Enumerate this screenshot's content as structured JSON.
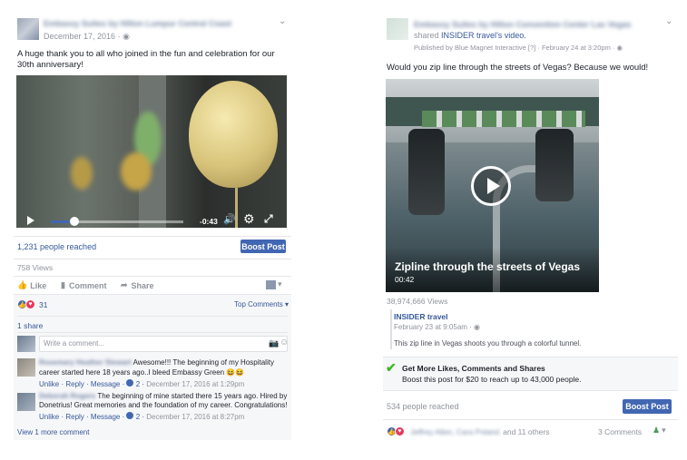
{
  "left_post": {
    "page_name": "Embassy Suites by Hilton Lumpur Central Coast",
    "date": "December 17, 2016",
    "text": "A huge thank you to all who joined in the fun and celebration for our 30th anniversary!",
    "video": {
      "time_remaining": "-0:43",
      "progress": 0.18
    },
    "people_reached": "1,231 people reached",
    "boost_label": "Boost Post",
    "views": "758 Views",
    "actions": {
      "like": "Like",
      "comment": "Comment",
      "share": "Share"
    },
    "reaction_count": "31",
    "top_comments": "Top Comments",
    "shares": "1 share",
    "comment_placeholder": "Write a comment...",
    "comments": [
      {
        "name": "Rosemary Heather Stewart",
        "text": "Awesome!!! The beginning of my Hospitality career started here 18 years ago..I bleed Embassy Green",
        "unlike": "Unlike",
        "reply": "Reply",
        "message": "Message",
        "likes": "2",
        "date": "December 17, 2016 at 1:29pm"
      },
      {
        "name": "Deborah Rogers",
        "text": "The beginning of mine started there 15 years ago. Hired by Donetrius! Great memories and the foundation of my career. Congratulations!",
        "unlike": "Unlike",
        "reply": "Reply",
        "message": "Message",
        "likes": "2",
        "date": "December 17, 2016 at 8:27pm"
      }
    ],
    "view_more": "View 1 more comment"
  },
  "right_post": {
    "page_name": "Embassy Suites by Hilton Convention Center Las Vegas",
    "shared_prefix": "shared",
    "shared_source": "INSIDER travel",
    "shared_suffix": "'s video.",
    "published_by": "Published by Blue Magnet Interactive",
    "published_q": "[?]",
    "published_date": "February 24 at 3:20pm",
    "text": "Would you zip line through the streets of Vegas? Because we would!",
    "video": {
      "title": "Zipline through the streets of Vegas",
      "duration": "00:42"
    },
    "views": "38,974,666 Views",
    "source": {
      "name": "INSIDER travel",
      "date": "February 23 at 9:05am",
      "description": "This zip line in Vegas shoots you through a colorful tunnel."
    },
    "promo": {
      "title": "Get More Likes, Comments and Shares",
      "text": "Boost this post for $20 to reach up to 43,000 people."
    },
    "people_reached": "534 people reached",
    "boost_label": "Boost Post",
    "reactions_names": "Jeffrey Allen, Cara Poland",
    "reactions_others": "and 11 others",
    "comments_count": "3 Comments"
  },
  "colors": {
    "fb_blue": "#4267b2",
    "link": "#365899",
    "muted": "#90949c",
    "green": "#42b72a"
  }
}
